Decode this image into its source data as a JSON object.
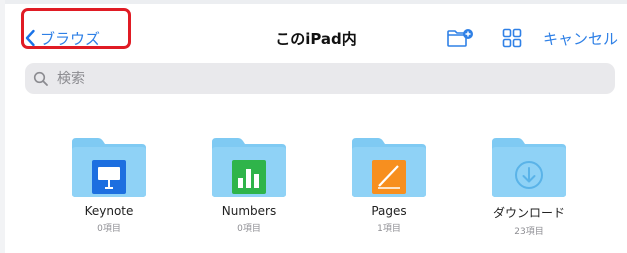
{
  "nav": {
    "back_label": "ブラウズ",
    "title": "このiPad内",
    "cancel_label": "キャンセル",
    "accent": "#2f80e6"
  },
  "search": {
    "placeholder": "検索"
  },
  "highlight_color": "#e01b24",
  "folders": [
    {
      "name": "Keynote",
      "count": "0項目",
      "app_icon": "keynote-icon",
      "app_color": "#1d6fe0"
    },
    {
      "name": "Numbers",
      "count": "0項目",
      "app_icon": "numbers-icon",
      "app_color": "#2fb44a"
    },
    {
      "name": "Pages",
      "count": "1項目",
      "app_icon": "pages-icon",
      "app_color": "#f78f1f"
    },
    {
      "name": "ダウンロード",
      "count": "23項目",
      "app_icon": "download-icon",
      "app_color": "#7cc5f2"
    }
  ],
  "folder_color": "#7fcaf3"
}
